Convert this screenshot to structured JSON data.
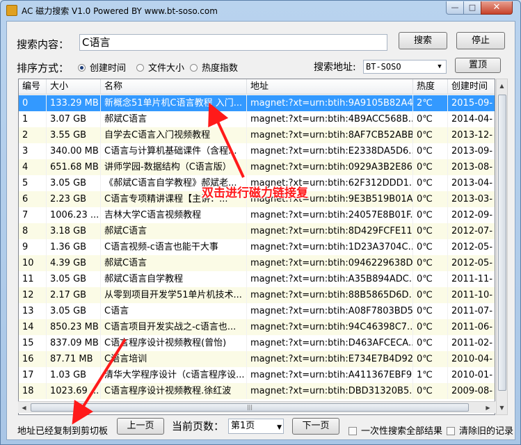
{
  "window": {
    "title": "AC 磁力搜索 V1.0 Powered BY www.bt-soso.com",
    "min": "—",
    "max": "□",
    "close": "✕"
  },
  "search": {
    "label": "搜索内容：",
    "value": "C语言",
    "search_button": "搜索",
    "stop_button": "停止"
  },
  "sort": {
    "label": "排序方式：",
    "options": [
      "创建时间",
      "文件大小",
      "热度指数"
    ],
    "selected": "创建时间"
  },
  "source": {
    "label": "搜索地址:",
    "value": "BT-SOSO",
    "top_button": "置顶"
  },
  "table": {
    "columns": [
      "编号",
      "大小",
      "名称",
      "地址",
      "热度",
      "创建时间"
    ],
    "rows": [
      [
        "0",
        "133.29 MB",
        "新概念51单片机C语言教程 入门...",
        "magnet:?xt=urn:btih:9A9105B82A4...",
        "2℃",
        "2015-09-"
      ],
      [
        "1",
        "3.07 GB",
        "郝斌C语言",
        "magnet:?xt=urn:btih:4B9ACC568B...",
        "0℃",
        "2014-04-"
      ],
      [
        "2",
        "3.55 GB",
        "自学去C语言入门视频教程",
        "magnet:?xt=urn:btih:8AF7CB52ABB...",
        "0℃",
        "2013-12-"
      ],
      [
        "3",
        "340.00 MB",
        "C语言与计算机基础课件（含程...",
        "magnet:?xt=urn:btih:E2338DA5D6...",
        "0℃",
        "2013-09-"
      ],
      [
        "4",
        "651.68 MB",
        "讲师学园-数据结构（C语言版）",
        "magnet:?xt=urn:btih:0929A3B2E86...",
        "0℃",
        "2013-08-"
      ],
      [
        "5",
        "3.05 GB",
        "《郝斌C语言自学教程》郝斌老...",
        "magnet:?xt=urn:btih:62F312DDD1...",
        "0℃",
        "2013-04-"
      ],
      [
        "6",
        "2.23 GB",
        "C语言专项精讲课程【主讲：...",
        "magnet:?xt=urn:btih:9E3B519B01A...",
        "0℃",
        "2013-03-"
      ],
      [
        "7",
        "1006.23 ...",
        "吉林大学C语言视频教程",
        "magnet:?xt=urn:btih:24057E8B01F...",
        "0℃",
        "2012-09-"
      ],
      [
        "8",
        "3.18 GB",
        "郝斌C语言",
        "magnet:?xt=urn:btih:8D429FCFE11...",
        "0℃",
        "2012-07-"
      ],
      [
        "9",
        "1.36 GB",
        "C语言视频-c语言也能干大事",
        "magnet:?xt=urn:btih:1D23A3704C...",
        "0℃",
        "2012-05-"
      ],
      [
        "10",
        "4.39 GB",
        "郝斌C语言",
        "magnet:?xt=urn:btih:0946229638D...",
        "0℃",
        "2012-05-"
      ],
      [
        "11",
        "3.05 GB",
        "郝斌C语言自学教程",
        "magnet:?xt=urn:btih:A35B894ADC...",
        "0℃",
        "2011-11-"
      ],
      [
        "12",
        "2.17 GB",
        "从零到项目开发学51单片机技术...",
        "magnet:?xt=urn:btih:88B5865D6D...",
        "0℃",
        "2011-10-"
      ],
      [
        "13",
        "3.05 GB",
        "C语言",
        "magnet:?xt=urn:btih:A08F7803BD5...",
        "0℃",
        "2011-07-"
      ],
      [
        "14",
        "850.23 MB",
        "C语言项目开发实战之-c语言也...",
        "magnet:?xt=urn:btih:94C46398C7...",
        "0℃",
        "2011-06-"
      ],
      [
        "15",
        "837.09 MB",
        "C语言程序设计视频教程(曾怡)",
        "magnet:?xt=urn:btih:D463AFCECA...",
        "0℃",
        "2011-02-"
      ],
      [
        "16",
        "87.71 MB",
        "C语言培训",
        "magnet:?xt=urn:btih:E734E7B4D92...",
        "0℃",
        "2010-04-"
      ],
      [
        "17",
        "1.03 GB",
        "清华大学程序设计（c语言程序设...",
        "magnet:?xt=urn:btih:A411367EBF9...",
        "1℃",
        "2010-01-"
      ],
      [
        "18",
        "1023.69 ...",
        "C语言程序设计视频教程.徐红波",
        "magnet:?xt=urn:btih:DBD31320B5...",
        "0℃",
        "2009-08-"
      ]
    ],
    "selected_row": 0
  },
  "footer": {
    "status": "地址已经复制到剪切板",
    "prev_button": "上一页",
    "page_label": "当前页数：",
    "page_value": "第1页",
    "next_button": "下一页",
    "check_all": "一次性搜索全部结果",
    "check_clear": "清除旧的记录"
  },
  "annotation": {
    "text": "双击进行磁力链接复",
    "color": "#ff1a1a"
  }
}
